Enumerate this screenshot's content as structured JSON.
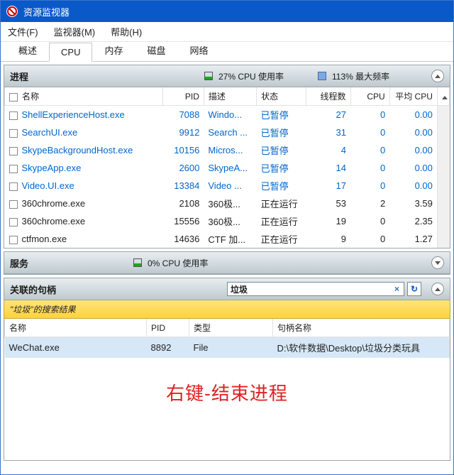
{
  "titlebar": {
    "title": "资源监视器"
  },
  "menu": {
    "file": "文件(F)",
    "monitor": "监视器(M)",
    "help": "帮助(H)"
  },
  "tabs": {
    "overview": "概述",
    "cpu": "CPU",
    "memory": "内存",
    "disk": "磁盘",
    "network": "网络"
  },
  "proc_section": {
    "title": "进程",
    "cpu_usage": "27% CPU 使用率",
    "max_freq": "113% 最大频率"
  },
  "proc_cols": {
    "name": "名称",
    "pid": "PID",
    "desc": "描述",
    "status": "状态",
    "threads": "线程数",
    "cpu": "CPU",
    "avgcpu": "平均 CPU"
  },
  "proc_rows": [
    {
      "name": "ShellExperienceHost.exe",
      "pid": "7088",
      "desc": "Windo...",
      "status": "已暂停",
      "threads": "27",
      "cpu": "0",
      "avg": "0.00",
      "link": true
    },
    {
      "name": "SearchUI.exe",
      "pid": "9912",
      "desc": "Search ...",
      "status": "已暂停",
      "threads": "31",
      "cpu": "0",
      "avg": "0.00",
      "link": true
    },
    {
      "name": "SkypeBackgroundHost.exe",
      "pid": "10156",
      "desc": "Micros...",
      "status": "已暂停",
      "threads": "4",
      "cpu": "0",
      "avg": "0.00",
      "link": true
    },
    {
      "name": "SkypeApp.exe",
      "pid": "2600",
      "desc": "SkypeA...",
      "status": "已暂停",
      "threads": "14",
      "cpu": "0",
      "avg": "0.00",
      "link": true
    },
    {
      "name": "Video.UI.exe",
      "pid": "13384",
      "desc": "Video ...",
      "status": "已暂停",
      "threads": "17",
      "cpu": "0",
      "avg": "0.00",
      "link": true
    },
    {
      "name": "360chrome.exe",
      "pid": "2108",
      "desc": "360极...",
      "status": "正在运行",
      "threads": "53",
      "cpu": "2",
      "avg": "3.59",
      "link": false
    },
    {
      "name": "360chrome.exe",
      "pid": "15556",
      "desc": "360极...",
      "status": "正在运行",
      "threads": "19",
      "cpu": "0",
      "avg": "2.35",
      "link": false
    },
    {
      "name": "ctfmon.exe",
      "pid": "14636",
      "desc": "CTF 加...",
      "status": "正在运行",
      "threads": "9",
      "cpu": "0",
      "avg": "1.27",
      "link": false
    }
  ],
  "svc_section": {
    "title": "服务",
    "cpu_usage": "0% CPU 使用率"
  },
  "handles_section": {
    "title": "关联的句柄",
    "search_value": "垃圾"
  },
  "handles_band": "\"垃圾\"的搜索结果",
  "handles_cols": {
    "name": "名称",
    "pid": "PID",
    "type": "类型",
    "hname": "句柄名称"
  },
  "handles_rows": [
    {
      "name": "WeChat.exe",
      "pid": "8892",
      "type": "File",
      "hname": "D:\\软件数据\\Desktop\\垃圾分类玩具"
    }
  ],
  "annotation": "右键-结束进程"
}
